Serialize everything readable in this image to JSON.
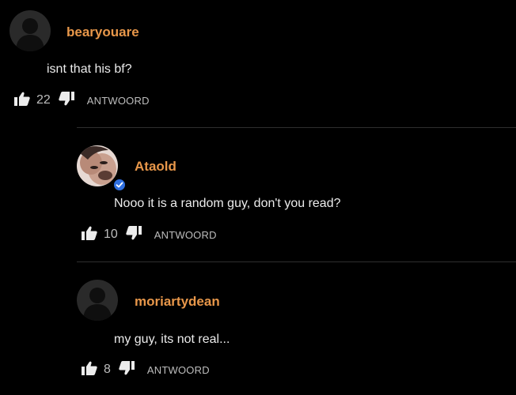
{
  "comments": [
    {
      "username": "bearyouare",
      "text": "isnt that his bf?",
      "likes": "22",
      "reply_label": "ANTWOORD",
      "avatar": "default-avatar",
      "verified": false
    },
    {
      "username": "Ataold",
      "text": "Nooo it is a random guy, don't you read?",
      "likes": "10",
      "reply_label": "ANTWOORD",
      "avatar": "photo-avatar",
      "verified": true
    },
    {
      "username": "moriartydean",
      "text": "my guy, its not real...",
      "likes": "8",
      "reply_label": "ANTWOORD",
      "avatar": "default-avatar",
      "verified": false
    }
  ],
  "colors": {
    "background": "#000000",
    "username": "#e8974a",
    "text": "#ececec",
    "muted": "#bdbdbd",
    "divider": "#2e2e2e",
    "verified": "#2f6fe0"
  },
  "icons": {
    "like": "thumbs-up-icon",
    "dislike": "thumbs-down-icon",
    "verified": "verified-check-icon"
  }
}
